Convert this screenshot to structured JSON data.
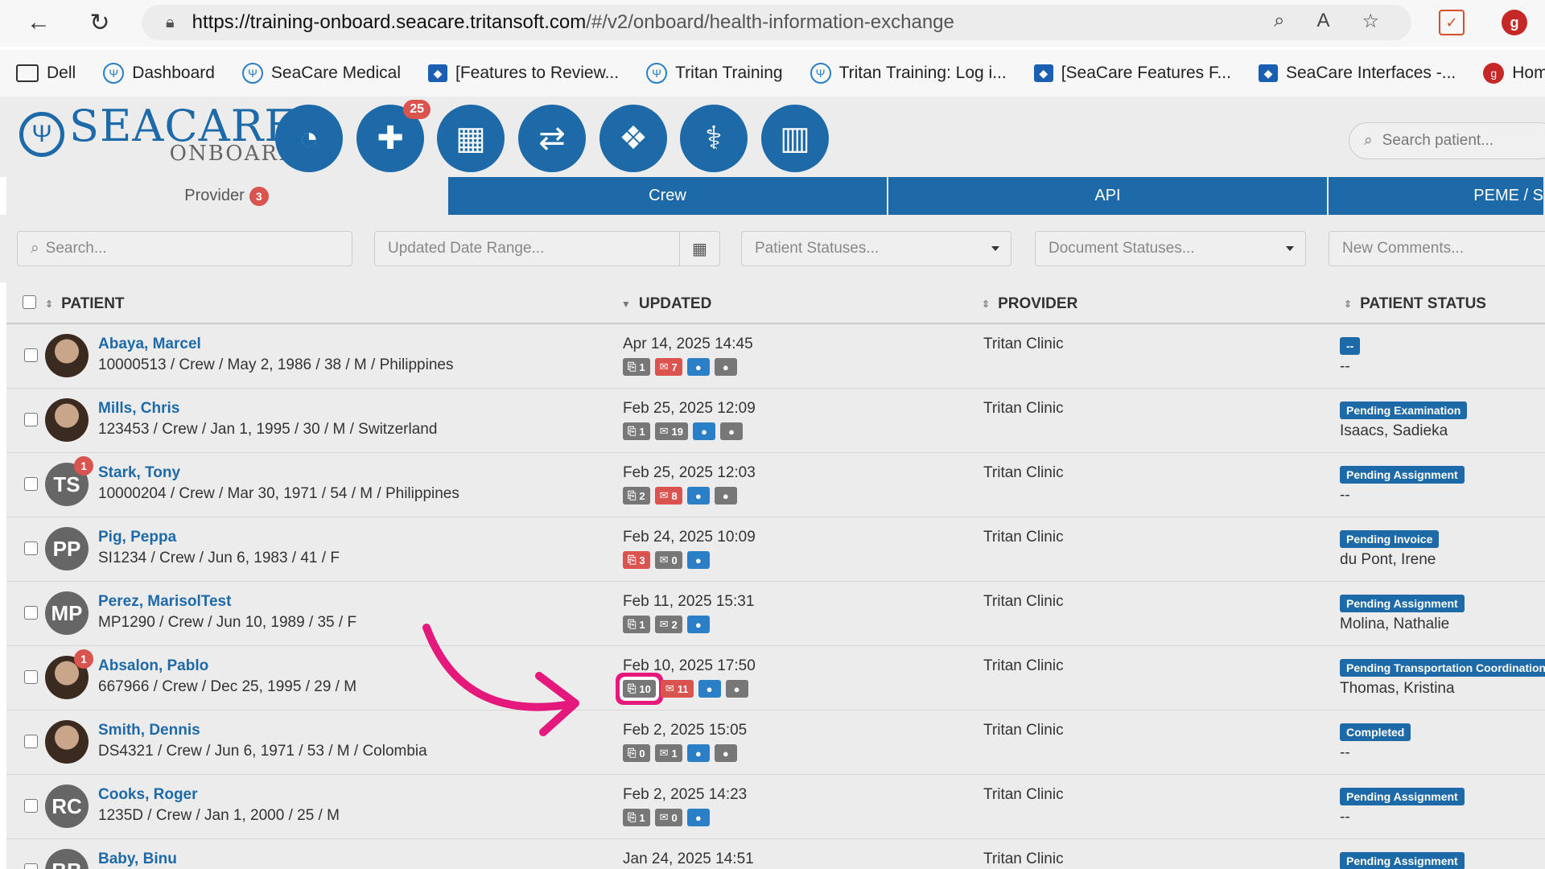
{
  "browser": {
    "url_host": "https://training-onboard.seacare.tritansoft.com",
    "url_path": "/#/v2/onboard/health-information-exchange",
    "bookmarks": [
      "Dell",
      "Dashboard",
      "SeaCare Medical",
      "[Features to Review...",
      "Tritan Training",
      "Tritan Training: Log i...",
      "[SeaCare Features F...",
      "SeaCare Interfaces -...",
      "Home | Gu"
    ]
  },
  "app": {
    "logo_main": "SEACARE",
    "logo_sub": "ONBOARD",
    "notification_count": "25",
    "search_placeholder": "Search patient..."
  },
  "tabs": [
    {
      "label": "Provider",
      "count": "3"
    },
    {
      "label": "Crew"
    },
    {
      "label": "API"
    },
    {
      "label": "PEME / S"
    }
  ],
  "filters": {
    "search": "Search...",
    "date_range": "Updated Date Range...",
    "patient_statuses": "Patient Statuses...",
    "document_statuses": "Document Statuses...",
    "new_comments": "New Comments..."
  },
  "columns": {
    "patient": "PATIENT",
    "updated": "UPDATED",
    "provider": "PROVIDER",
    "patient_status": "PATIENT STATUS"
  },
  "rows": [
    {
      "initials": "",
      "badge": "",
      "name": "Abaya, Marcel",
      "info": "10000513 / Crew / May 2, 1986 / 38 / M / Philippines",
      "updated": "Apr 14, 2025 14:45",
      "attach": "1",
      "comments": "7",
      "provider": "Tritan Clinic",
      "status": "--",
      "assignee": "--"
    },
    {
      "initials": "",
      "badge": "",
      "name": "Mills, Chris",
      "info": "123453 / Crew / Jan 1, 1995 / 30 / M / Switzerland",
      "updated": "Feb 25, 2025 12:09",
      "attach": "1",
      "comments": "19",
      "provider": "Tritan Clinic",
      "status": "Pending Examination",
      "assignee": "Isaacs, Sadieka"
    },
    {
      "initials": "TS",
      "badge": "1",
      "name": "Stark, Tony",
      "info": "10000204 / Crew / Mar 30, 1971 / 54 / M / Philippines",
      "updated": "Feb 25, 2025 12:03",
      "attach": "2",
      "comments": "8",
      "provider": "Tritan Clinic",
      "status": "Pending Assignment",
      "assignee": "--"
    },
    {
      "initials": "PP",
      "badge": "",
      "name": "Pig, Peppa",
      "info": "SI1234 / Crew / Jun 6, 1983 / 41 / F",
      "updated": "Feb 24, 2025 10:09",
      "attach": "3",
      "comments": "0",
      "provider": "Tritan Clinic",
      "status": "Pending Invoice",
      "assignee": "du Pont, Irene"
    },
    {
      "initials": "MP",
      "badge": "",
      "name": "Perez, MarisolTest",
      "info": "MP1290 / Crew / Jun 10, 1989 / 35 / F",
      "updated": "Feb 11, 2025 15:31",
      "attach": "1",
      "comments": "2",
      "provider": "Tritan Clinic",
      "status": "Pending Assignment",
      "assignee": "Molina, Nathalie"
    },
    {
      "initials": "",
      "badge": "1",
      "name": "Absalon, Pablo",
      "info": "667966 / Crew / Dec 25, 1995 / 29 / M",
      "updated": "Feb 10, 2025 17:50",
      "attach": "10",
      "comments": "11",
      "provider": "Tritan Clinic",
      "status": "Pending Transportation Coordination",
      "assignee": "Thomas, Kristina"
    },
    {
      "initials": "",
      "badge": "",
      "name": "Smith, Dennis",
      "info": "DS4321 / Crew / Jun 6, 1971 / 53 / M / Colombia",
      "updated": "Feb 2, 2025 15:05",
      "attach": "0",
      "comments": "1",
      "provider": "Tritan Clinic",
      "status": "Completed",
      "assignee": "--"
    },
    {
      "initials": "RC",
      "badge": "",
      "name": "Cooks, Roger",
      "info": "1235D / Crew / Jan 1, 2000 / 25 / M",
      "updated": "Feb 2, 2025 14:23",
      "attach": "1",
      "comments": "0",
      "provider": "Tritan Clinic",
      "status": "Pending Assignment",
      "assignee": "--"
    },
    {
      "initials": "BB",
      "badge": "",
      "name": "Baby, Binu",
      "info": "",
      "updated": "Jan 24, 2025 14:51",
      "attach": "",
      "comments": "",
      "provider": "Tritan Clinic",
      "status": "Pending Assignment",
      "assignee": ""
    }
  ],
  "colors": {
    "brand": "#1e6aa8",
    "badge_red": "#d9534f",
    "highlight": "#e5197c"
  }
}
